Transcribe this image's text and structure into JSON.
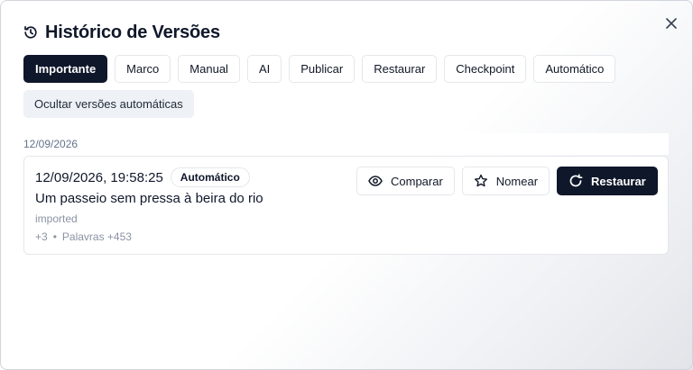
{
  "dialog": {
    "title": "Histórico de Versões",
    "title_icon": "history-icon",
    "close_icon": "close-icon"
  },
  "filters": {
    "chips": [
      {
        "label": "Importante",
        "active": true
      },
      {
        "label": "Marco",
        "active": false
      },
      {
        "label": "Manual",
        "active": false
      },
      {
        "label": "AI",
        "active": false
      },
      {
        "label": "Publicar",
        "active": false
      },
      {
        "label": "Restaurar",
        "active": false
      },
      {
        "label": "Checkpoint",
        "active": false
      },
      {
        "label": "Automático",
        "active": false
      }
    ],
    "hide_auto_label": "Ocultar versões automáticas"
  },
  "group": {
    "date": "12/09/2026",
    "versions": [
      {
        "timestamp": "12/09/2026, 19:58:25",
        "badge": "Automático",
        "title": "Um passeio sem pressa à beira do rio",
        "source": "imported",
        "delta": "+3",
        "separator": "•",
        "words": "Palavras +453"
      }
    ]
  },
  "actions": {
    "compare_label": "Comparar",
    "compare_icon": "eye-icon",
    "name_label": "Nomear",
    "name_icon": "star-icon",
    "restore_label": "Restaurar",
    "restore_icon": "refresh-icon"
  },
  "colors": {
    "primary": "#0f172a",
    "border": "#e5e7eb",
    "muted_text": "#8a93a3",
    "chip_bg_secondary": "#eef1f5"
  }
}
